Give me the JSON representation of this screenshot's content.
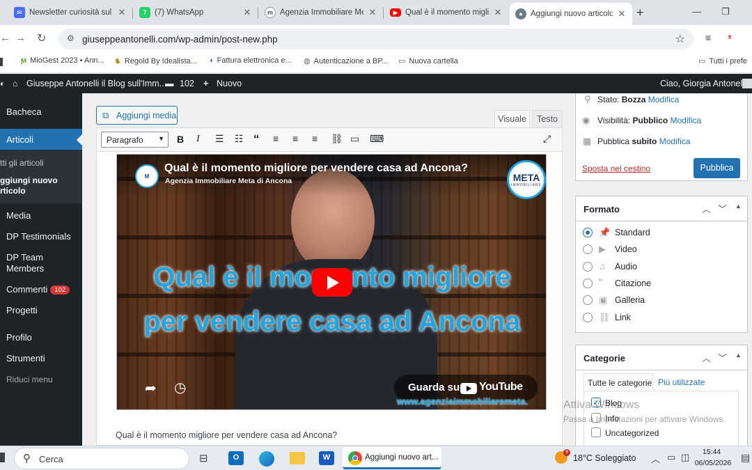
{
  "browser": {
    "tabs": [
      {
        "title": "Newsletter curiosità sul m",
        "icon": "mail-icon"
      },
      {
        "title": "(7) WhatsApp",
        "icon": "whatsapp-icon",
        "icon_text": "7"
      },
      {
        "title": "Agenzia Immobiliare Met",
        "icon": "meta-logo-icon"
      },
      {
        "title": "Qual è il momento miglio",
        "icon": "youtube-icon"
      },
      {
        "title": "Aggiungi nuovo articolo",
        "icon": "avatar-icon"
      }
    ],
    "new_tab": "+",
    "window_controls": {
      "minimize": "—",
      "restore": "❐",
      "close": "✕"
    },
    "url": "giuseppeantonelli.com/wp-admin/post-new.php",
    "bookmarks": [
      {
        "label": "MioGest 2023 • Ann..."
      },
      {
        "label": "Regold By Idealista..."
      },
      {
        "label": "Fattura elettronica e..."
      },
      {
        "label": "Autenticazione a BP..."
      },
      {
        "label": "Nuova cartella"
      }
    ],
    "all_bookmarks": "Tutti i prefe"
  },
  "adminbar": {
    "site": "Giuseppe Antonelli il Blog sull'Imm...",
    "comments": "102",
    "new": "Nuovo",
    "greeting": "Ciao, Giorgia Antonelli"
  },
  "sidebar": {
    "items": [
      {
        "label": "Bacheca"
      },
      {
        "label": "Articoli"
      },
      {
        "label": "Media"
      },
      {
        "label": "DP Testimonials"
      },
      {
        "label": "DP Team"
      },
      {
        "label": "Members"
      },
      {
        "label": "Commenti"
      },
      {
        "label": "Progetti"
      },
      {
        "label": "Profilo"
      },
      {
        "label": "Strumenti"
      },
      {
        "label": "Riduci menu"
      }
    ],
    "submenu": [
      "tti gli articoli",
      "ggiungi nuovo",
      "rticolo"
    ],
    "comments_badge": "102"
  },
  "editor": {
    "add_media": "Aggiungi media",
    "tab_visual": "Visuale",
    "tab_text": "Testo",
    "format_select": "Paragrafo",
    "video": {
      "title": "Qual è il momento migliore per vendere casa ad Ancona?",
      "channel": "Agenzia Immobiliare Meta di Ancona",
      "logo_text": "META",
      "logo_sub": "IMMOBILIARE",
      "overlay_line1": "Qual è il momento migliore",
      "overlay_line2": "per vendere casa ad Ancona",
      "watch_on": "Guarda su",
      "youtube": "YouTube",
      "website": "www.agenziaimmobiliaremeta."
    },
    "body_text": "Qual è il momento migliore per vendere casa ad Ancona?"
  },
  "publish": {
    "status_label": "Stato:",
    "status_value": "Bozza",
    "visibility_label": "Visibilità:",
    "visibility_value": "Pubblico",
    "publish_label": "Pubblica",
    "publish_value": "subito",
    "edit": "Modifica",
    "trash": "Sposta nel cestino",
    "publish_button": "Pubblica"
  },
  "format_box": {
    "title": "Formato",
    "options": [
      {
        "label": "Standard",
        "checked": true
      },
      {
        "label": "Video",
        "checked": false
      },
      {
        "label": "Audio",
        "checked": false
      },
      {
        "label": "Citazione",
        "checked": false
      },
      {
        "label": "Galleria",
        "checked": false
      },
      {
        "label": "Link",
        "checked": false
      }
    ]
  },
  "categories_box": {
    "title": "Categorie",
    "tab_all": "Tutte le categorie",
    "tab_most": "Più utilizzate",
    "items": [
      {
        "label": "Blog",
        "checked": true
      },
      {
        "label": "Info",
        "checked": false
      },
      {
        "label": "Uncategorized",
        "checked": false
      }
    ]
  },
  "watermark": {
    "line1": "Attiva Windows",
    "line2": "Passa a Impostazioni per attivare Windows."
  },
  "taskbar": {
    "search": "Cerca",
    "chrome_window": "Aggiungi nuovo art...",
    "weather_badge": "9",
    "weather": "18°C  Soleggiato",
    "time": "15:44",
    "date": "06/05/2026"
  },
  "colors": {
    "wp_dark": "#1d2327",
    "wp_blue": "#2271b1",
    "youtube_red": "#ff0000",
    "video_text_blue": "#1fa6e0"
  }
}
